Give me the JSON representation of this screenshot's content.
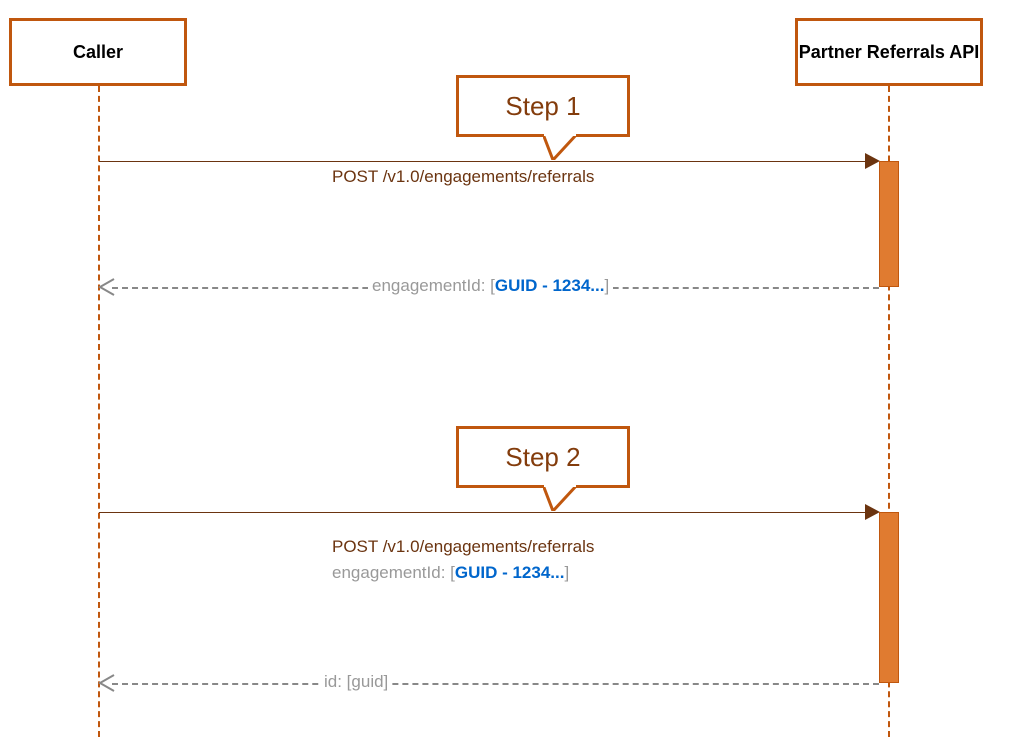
{
  "actors": {
    "left": "Caller",
    "right": "Partner Referrals API"
  },
  "steps": {
    "step1": {
      "label": "Step 1",
      "request": "POST /v1.0/engagements/referrals",
      "response_prefix": "engagementId: [",
      "response_value": "GUID - 1234...",
      "response_suffix": "]"
    },
    "step2": {
      "label": "Step 2",
      "request_line1": "POST /v1.0/engagements/referrals",
      "request_line2_prefix": "engagementId: [",
      "request_line2_value": "GUID - 1234...",
      "request_line2_suffix": "]",
      "response_prefix": "id: [",
      "response_value": "guid",
      "response_suffix": "]"
    }
  }
}
